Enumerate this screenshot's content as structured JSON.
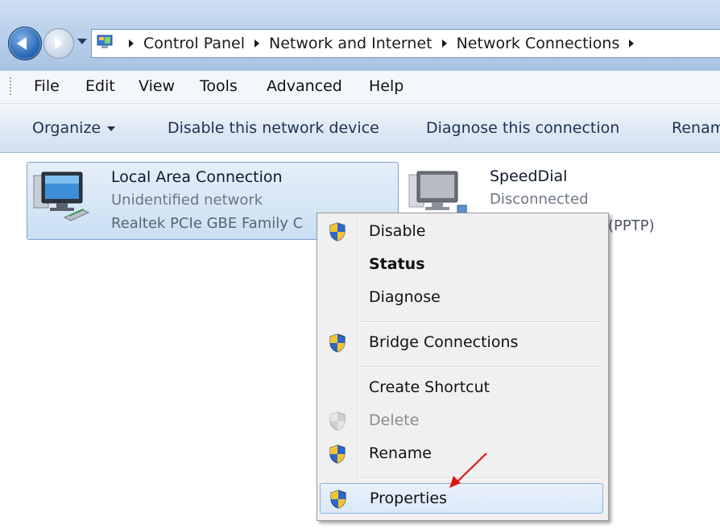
{
  "breadcrumb": [
    "Control Panel",
    "Network and Internet",
    "Network Connections"
  ],
  "menubar": [
    "File",
    "Edit",
    "View",
    "Tools",
    "Advanced",
    "Help"
  ],
  "commands": {
    "organize": "Organize",
    "disable": "Disable this network device",
    "diagnose": "Diagnose this connection",
    "rename": "Renam"
  },
  "connections": [
    {
      "name": "Local Area Connection",
      "status": "Unidentified network",
      "device": "Realtek PCIe GBE Family C"
    },
    {
      "name": "SpeedDial",
      "status": "Disconnected",
      "device": "(PPTP)"
    }
  ],
  "context_menu": {
    "disable": "Disable",
    "status": "Status",
    "diagnose": "Diagnose",
    "bridge": "Bridge Connections",
    "shortcut": "Create Shortcut",
    "delete": "Delete",
    "rename": "Rename",
    "properties": "Properties"
  },
  "colors": {
    "accent_arrow": "#e01414",
    "selection": "#cadff3"
  },
  "icons": [
    "back-arrow-icon",
    "forward-arrow-icon",
    "control-panel-icon",
    "network-computer-icon",
    "uac-shield-icon"
  ]
}
